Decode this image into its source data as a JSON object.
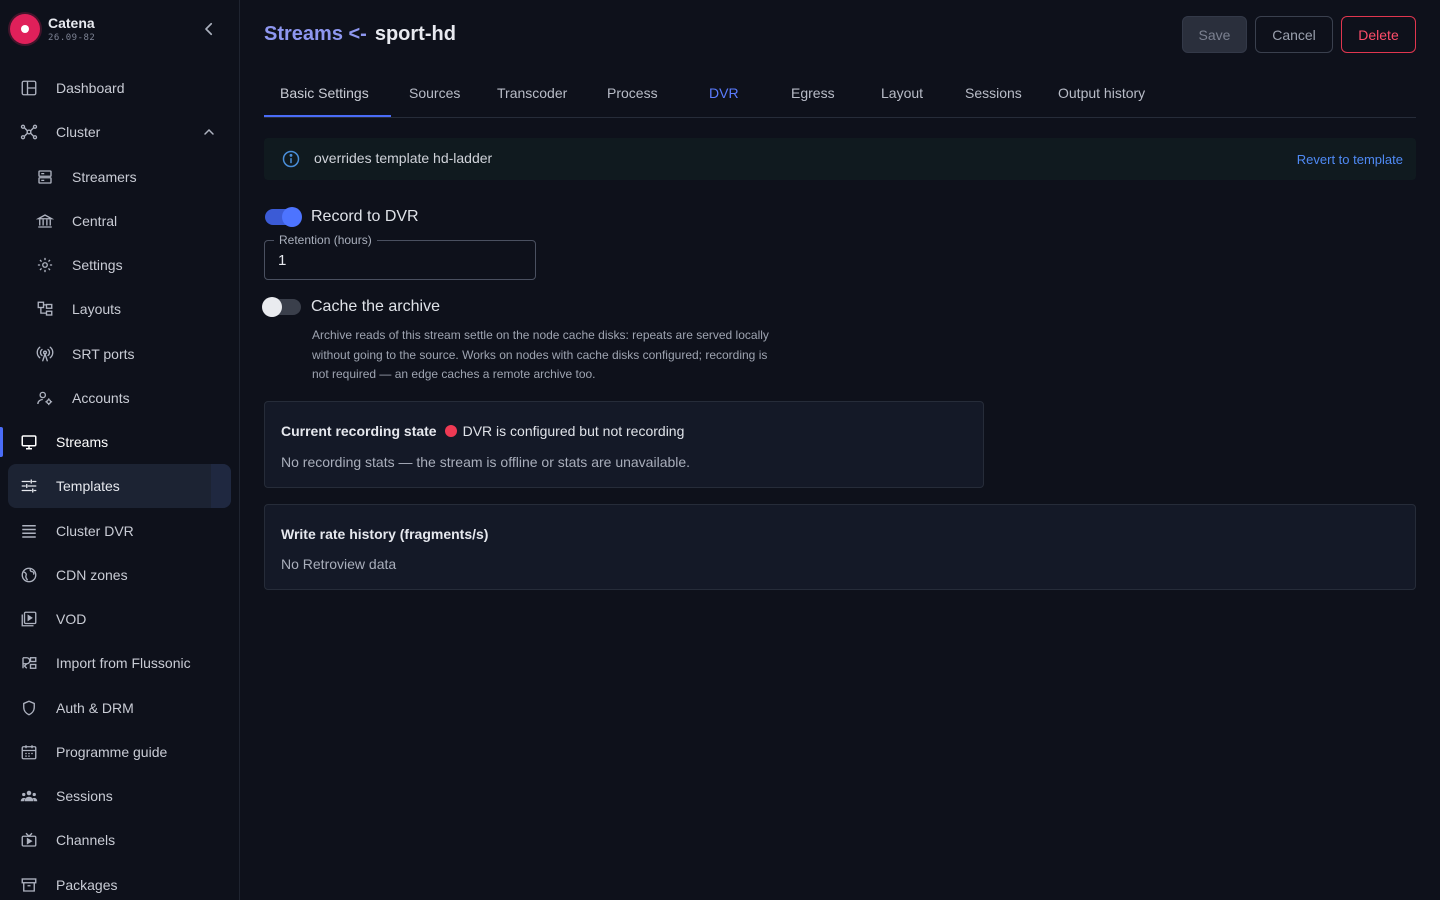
{
  "brand": {
    "name": "Catena",
    "version": "26.09-82"
  },
  "sidebar": {
    "items": [
      {
        "label": "Dashboard",
        "icon": "dashboard-icon"
      },
      {
        "label": "Cluster",
        "icon": "cluster-icon"
      },
      {
        "label": "Streamers",
        "icon": "server-icon"
      },
      {
        "label": "Central",
        "icon": "bank-icon"
      },
      {
        "label": "Settings",
        "icon": "gear-icon"
      },
      {
        "label": "Layouts",
        "icon": "layout-icon"
      },
      {
        "label": "SRT ports",
        "icon": "antenna-icon"
      },
      {
        "label": "Accounts",
        "icon": "accounts-icon"
      },
      {
        "label": "Streams",
        "icon": "monitor-icon"
      },
      {
        "label": "Templates",
        "icon": "sliders-icon"
      },
      {
        "label": "Cluster DVR",
        "icon": "list-icon"
      },
      {
        "label": "CDN zones",
        "icon": "globe-icon"
      },
      {
        "label": "VOD",
        "icon": "video-library-icon"
      },
      {
        "label": "Import from Flussonic",
        "icon": "import-icon"
      },
      {
        "label": "Auth & DRM",
        "icon": "shield-icon"
      },
      {
        "label": "Programme guide",
        "icon": "calendar-icon"
      },
      {
        "label": "Sessions",
        "icon": "people-icon"
      },
      {
        "label": "Channels",
        "icon": "tv-icon"
      },
      {
        "label": "Packages",
        "icon": "archive-icon"
      }
    ]
  },
  "header": {
    "crumb": "Streams <-",
    "name": "sport-hd",
    "save_label": "Save",
    "cancel_label": "Cancel",
    "delete_label": "Delete"
  },
  "tabs": [
    {
      "label": "Basic Settings"
    },
    {
      "label": "Sources"
    },
    {
      "label": "Transcoder"
    },
    {
      "label": "Process"
    },
    {
      "label": "DVR"
    },
    {
      "label": "Egress"
    },
    {
      "label": "Layout"
    },
    {
      "label": "Sessions"
    },
    {
      "label": "Output history"
    }
  ],
  "banner": {
    "text": "overrides template hd-ladder",
    "action": "Revert to template"
  },
  "dvr": {
    "record_label": "Record to DVR",
    "record_on": true,
    "retention_label": "Retention (hours)",
    "retention_value": "1",
    "cache_label": "Cache the archive",
    "cache_on": false,
    "cache_help_lines": [
      "Archive reads of this stream settle on the node cache disks: repeats are served locally",
      "without going to the source. Works on nodes with cache disks configured; recording is",
      "not required — an edge caches a remote archive too."
    ]
  },
  "recording_card": {
    "title": "Current recording state",
    "status": "DVR is configured but not recording",
    "status_color": "#ef3a54",
    "message": "No recording stats — the stream is offline or stats are unavailable."
  },
  "write_rate_card": {
    "title": "Write rate history (fragments/s)",
    "message": "No Retroview data"
  },
  "colors": {
    "accent": "#4a6cf7",
    "danger": "#e0364f",
    "brand": "#e0205a"
  }
}
